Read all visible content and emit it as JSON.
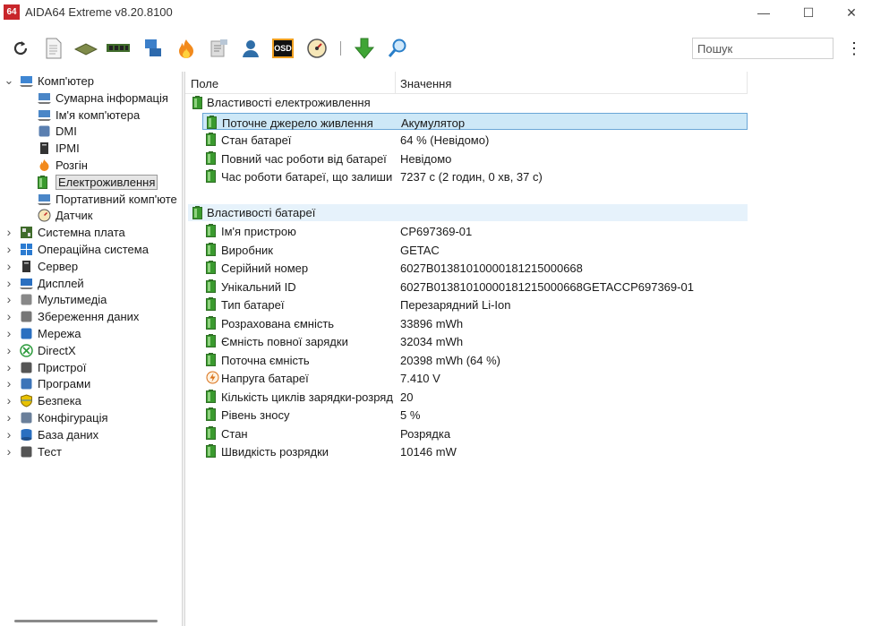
{
  "window": {
    "app_badge": "64",
    "title": "AIDA64 Extreme v8.20.8100",
    "controls": {
      "minimize": "—",
      "maximize": "☐",
      "close": "✕"
    }
  },
  "toolbar": {
    "icons": [
      "refresh-icon",
      "report-icon",
      "motherboard-icon",
      "memory-icon",
      "network-icon",
      "flame-icon",
      "audit-icon",
      "user-icon",
      "osd-icon",
      "gauge-icon",
      "download-icon",
      "search-icon"
    ],
    "osd_label": "OSD",
    "search_placeholder": "Пошук",
    "menu_glyph": "⋮"
  },
  "tree": {
    "root": {
      "label": "Комп'ютер",
      "expanded": true
    },
    "children": [
      {
        "label": "Сумарна інформація",
        "icon": "summary-icon"
      },
      {
        "label": "Ім'я комп'ютера",
        "icon": "computer-name-icon"
      },
      {
        "label": "DMI",
        "icon": "dmi-icon"
      },
      {
        "label": "IPMI",
        "icon": "ipmi-icon"
      },
      {
        "label": "Розгін",
        "icon": "overclock-icon"
      },
      {
        "label": "Електроживлення",
        "icon": "power-icon",
        "selected": true
      },
      {
        "label": "Портативний комп'юте",
        "icon": "portable-icon"
      },
      {
        "label": "Датчик",
        "icon": "sensor-icon"
      }
    ],
    "sections": [
      {
        "label": "Системна плата",
        "icon": "motherboard-icon"
      },
      {
        "label": "Операційна система",
        "icon": "windows-icon"
      },
      {
        "label": "Сервер",
        "icon": "server-icon"
      },
      {
        "label": "Дисплей",
        "icon": "display-icon"
      },
      {
        "label": "Мультимедіа",
        "icon": "multimedia-icon"
      },
      {
        "label": "Збереження даних",
        "icon": "storage-icon"
      },
      {
        "label": "Мережа",
        "icon": "network-icon"
      },
      {
        "label": "DirectX",
        "icon": "directx-icon"
      },
      {
        "label": "Пристрої",
        "icon": "devices-icon"
      },
      {
        "label": "Програми",
        "icon": "programs-icon"
      },
      {
        "label": "Безпека",
        "icon": "security-icon"
      },
      {
        "label": "Конфігурація",
        "icon": "config-icon"
      },
      {
        "label": "База даних",
        "icon": "database-icon"
      },
      {
        "label": "Тест",
        "icon": "benchmark-icon"
      }
    ]
  },
  "grid": {
    "columns": {
      "field": "Поле",
      "value": "Значення"
    },
    "groups": [
      {
        "title": "Властивості електроживлення",
        "rows": [
          {
            "field": "Поточне джерело живлення",
            "value": "Акумулятор",
            "icon": "battery-icon",
            "selected": true
          },
          {
            "field": "Стан батареї",
            "value": "64 % (Невідомо)",
            "icon": "battery-icon"
          },
          {
            "field": "Повний час роботи від батареї",
            "value": "Невідомо",
            "icon": "battery-icon"
          },
          {
            "field": "Час роботи батареї, що залишився",
            "value": "7237 с (2 годин, 0 хв, 37 с)",
            "icon": "battery-icon"
          }
        ]
      },
      {
        "title": "Властивості батареї",
        "rows": [
          {
            "field": "Ім'я пристрою",
            "value": "CP697369-01",
            "icon": "battery-icon"
          },
          {
            "field": "Виробник",
            "value": "GETAC",
            "icon": "battery-icon"
          },
          {
            "field": "Серійний номер",
            "value": "6027B0138101000018121500066​8",
            "icon": "battery-icon"
          },
          {
            "field": "Унікальний ID",
            "value": "6027B0138101000018121500066​8GETACCP697369-01",
            "icon": "battery-icon"
          },
          {
            "field": "Тип батареї",
            "value": "Перезарядний Li-Ion",
            "icon": "battery-icon"
          },
          {
            "field": "Розрахована ємність",
            "value": "33896 mWh",
            "icon": "battery-icon"
          },
          {
            "field": "Ємність повної зарядки",
            "value": "32034 mWh",
            "icon": "battery-icon"
          },
          {
            "field": "Поточна ємність",
            "value": "20398 mWh  (64 %)",
            "icon": "battery-icon"
          },
          {
            "field": "Напруга батареї",
            "value": "7.410 V",
            "icon": "voltage-icon"
          },
          {
            "field": "Кількість циклів зарядки-розрядки",
            "value": "20",
            "icon": "battery-icon"
          },
          {
            "field": "Рівень зносу",
            "value": "5 %",
            "icon": "battery-icon"
          },
          {
            "field": "Стан",
            "value": "Розрядка",
            "icon": "battery-icon"
          },
          {
            "field": "Швидкість розрядки",
            "value": "10146 mW",
            "icon": "battery-icon"
          }
        ]
      }
    ]
  },
  "colors": {
    "accent": "#0078d4",
    "selection": "#cde8f7",
    "group_shade": "#e6f2fb",
    "battery": "#3a9a2e"
  }
}
